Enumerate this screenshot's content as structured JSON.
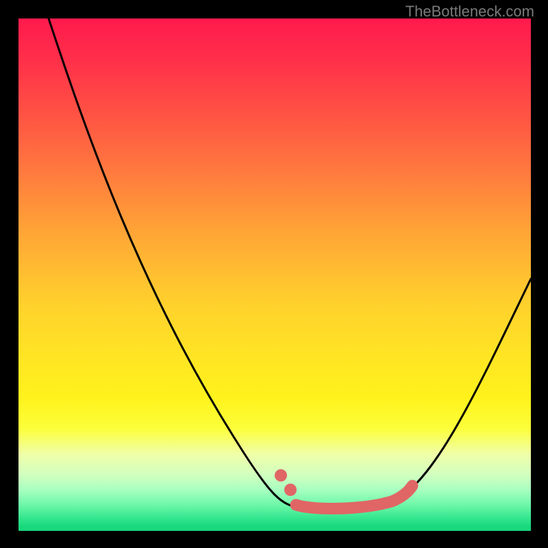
{
  "watermark": "TheBottleneck.com",
  "colors": {
    "gradient_top": "#ff1a4d",
    "gradient_mid": "#ffe524",
    "gradient_bottom": "#18d67b",
    "curve": "#000000",
    "marker": "#e06666",
    "background": "#000000",
    "watermark_text": "#7a7a7a"
  },
  "chart_data": {
    "type": "line",
    "title": "",
    "xlabel": "",
    "ylabel": "",
    "x": [
      0.06,
      0.15,
      0.25,
      0.35,
      0.43,
      0.5,
      0.55,
      0.6,
      0.65,
      0.7,
      0.75,
      0.82,
      0.9,
      1.0
    ],
    "values": [
      1.0,
      0.78,
      0.58,
      0.4,
      0.24,
      0.12,
      0.06,
      0.04,
      0.04,
      0.05,
      0.08,
      0.16,
      0.3,
      0.49
    ],
    "xlim": [
      0,
      1
    ],
    "ylim": [
      0,
      1
    ],
    "highlight_region_x": [
      0.51,
      0.77
    ],
    "annotations": [],
    "note": "Axes have no visible tick labels; values are normalized estimates read from curve position within the gradient plot area. Lower y (near 0) corresponds to the green optimal region; higher y (near 1) is the red bottleneck region."
  }
}
